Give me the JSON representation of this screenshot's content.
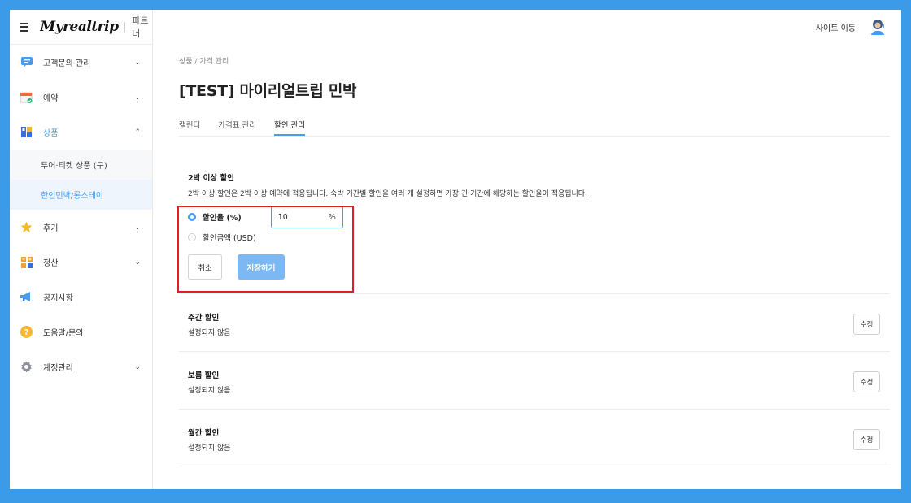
{
  "brand": {
    "logo": "Myrealtrip",
    "sub": "파트너"
  },
  "header": {
    "site_link": "사이트 이동"
  },
  "sidebar": {
    "items": [
      {
        "label": "고객문의 관리",
        "icon": "chat-icon",
        "expandable": true
      },
      {
        "label": "예약",
        "icon": "calendar-icon",
        "expandable": true
      },
      {
        "label": "상품",
        "icon": "grid-icon",
        "expandable": true,
        "active": true
      },
      {
        "label": "후기",
        "icon": "star-icon",
        "expandable": true
      },
      {
        "label": "정산",
        "icon": "calculator-icon",
        "expandable": true
      },
      {
        "label": "공지사항",
        "icon": "megaphone-icon",
        "expandable": false
      },
      {
        "label": "도움말/문의",
        "icon": "help-icon",
        "expandable": false
      },
      {
        "label": "계정관리",
        "icon": "gear-icon",
        "expandable": true
      }
    ],
    "subitems": [
      {
        "label": "투어·티켓 상품 (구)"
      },
      {
        "label": "한인민박/롱스테이",
        "active": true
      }
    ]
  },
  "main": {
    "breadcrumb": "상품 / 가격 관리",
    "title": "[TEST] 마이리얼트립 민박",
    "tabs": [
      {
        "label": "캘린더"
      },
      {
        "label": "가격표 관리"
      },
      {
        "label": "할인 관리",
        "active": true
      }
    ]
  },
  "discount2": {
    "title": "2박 이상 할인",
    "description": "2박 이상 할인은 2박 이상 예약에 적용됩니다. 숙박 기간별 할인을 여러 개 설정하면 가장 긴 기간에 해당하는 할인율이 적용됩니다.",
    "option_rate": "할인율 (%)",
    "option_amount": "할인금액 (USD)",
    "rate_value": "10",
    "rate_unit": "%",
    "cancel_label": "취소",
    "save_label": "저장하기"
  },
  "sections": [
    {
      "title": "주간 할인",
      "status": "설정되지 않음",
      "edit_label": "수정"
    },
    {
      "title": "보름 할인",
      "status": "설정되지 않음",
      "edit_label": "수정"
    },
    {
      "title": "월간 할인",
      "status": "설정되지 않음",
      "edit_label": "수정"
    }
  ],
  "colors": {
    "accent": "#4a9bf0",
    "highlight": "#e02020",
    "background": "#3b9be8"
  }
}
